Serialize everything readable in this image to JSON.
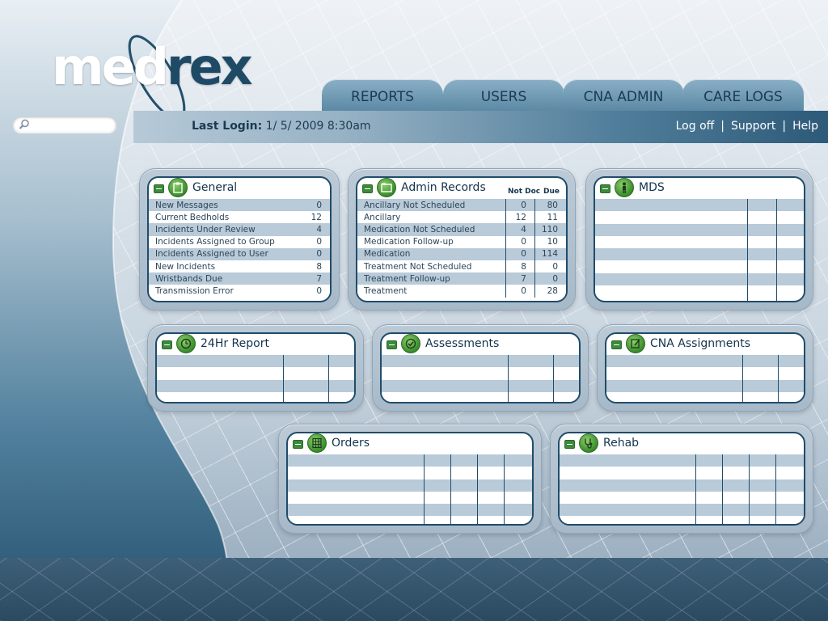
{
  "brand": {
    "logo_main": "med",
    "logo_ex": "ex",
    "logo_r": "r"
  },
  "search": {
    "placeholder": ""
  },
  "tabs": [
    {
      "label": "REPORTS"
    },
    {
      "label": "USERS"
    },
    {
      "label": "CNA ADMIN"
    },
    {
      "label": "CARE LOGS"
    }
  ],
  "login": {
    "label": "Last Login:",
    "value": "1/ 5/ 2009  8:30am"
  },
  "toplinks": {
    "logoff": "Log off",
    "support": "Support",
    "help": "Help",
    "sep": "|"
  },
  "panels": {
    "general": {
      "title": "General",
      "rows": [
        {
          "label": "New  Messages",
          "value": "0"
        },
        {
          "label": "Current  Bedholds",
          "value": "12"
        },
        {
          "label": "Incidents  Under  Review",
          "value": "4"
        },
        {
          "label": "Incidents  Assigned  to  Group",
          "value": "0"
        },
        {
          "label": "Incidents  Assigned  to  User",
          "value": "0"
        },
        {
          "label": "New  Incidents",
          "value": "8"
        },
        {
          "label": "Wristbands  Due",
          "value": "7"
        },
        {
          "label": "Transmission  Error",
          "value": "0"
        }
      ]
    },
    "admin": {
      "title": "Admin  Records",
      "col1": "Not Doc",
      "col2": "Due",
      "rows": [
        {
          "label": "Ancillary  Not  Scheduled",
          "notdoc": "0",
          "due": "80"
        },
        {
          "label": "Ancillary",
          "notdoc": "12",
          "due": "11"
        },
        {
          "label": "Medication  Not  Scheduled",
          "notdoc": "4",
          "due": "110"
        },
        {
          "label": "Medication  Follow-up",
          "notdoc": "0",
          "due": "10"
        },
        {
          "label": "Medication",
          "notdoc": "0",
          "due": "114"
        },
        {
          "label": "Treatment  Not  Scheduled",
          "notdoc": "8",
          "due": "0"
        },
        {
          "label": "Treatment  Follow-up",
          "notdoc": "7",
          "due": "0"
        },
        {
          "label": "Treatment",
          "notdoc": "0",
          "due": "28"
        }
      ]
    },
    "mds": {
      "title": "MDS"
    },
    "report24": {
      "title": "24Hr  Report"
    },
    "assessments": {
      "title": "Assessments"
    },
    "cna": {
      "title": "CNA  Assignments"
    },
    "orders": {
      "title": "Orders"
    },
    "rehab": {
      "title": "Rehab"
    }
  },
  "colors": {
    "accent": "#1f4c6b",
    "icon_green": "#3a8a2c",
    "row_stripe": "#b9cad8"
  }
}
